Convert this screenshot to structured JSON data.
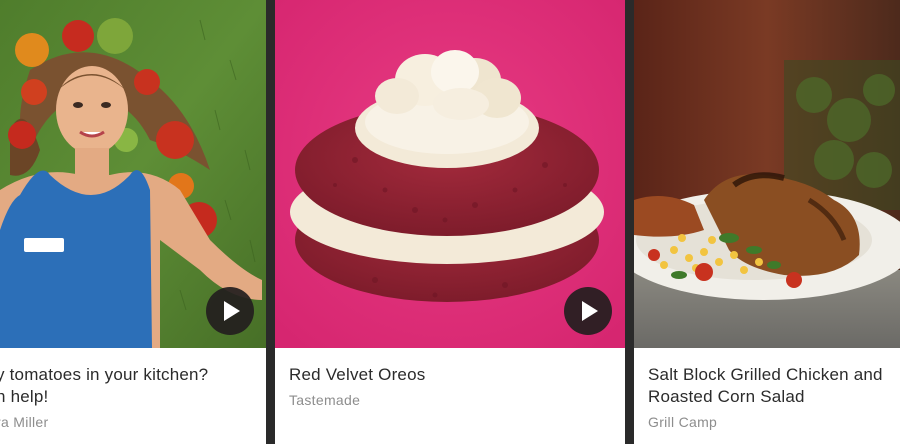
{
  "cards": [
    {
      "title_line1": "y tomatoes in your kitchen?",
      "title_line2": "n help!",
      "author": "ra Miller",
      "video": "play-icon"
    },
    {
      "title_line1": "Red Velvet Oreos",
      "title_line2": "",
      "author": "Tastemade",
      "video": "play-icon"
    },
    {
      "title_line1": "Salt Block Grilled Chicken and",
      "title_line2": "Roasted Corn Salad",
      "author": "Grill Camp",
      "video": "none"
    }
  ],
  "colors": {
    "gap": "#2a2a2a",
    "title": "#2b2b2b",
    "author": "#8d8d8d",
    "pink_bg": "#dc2a73"
  }
}
